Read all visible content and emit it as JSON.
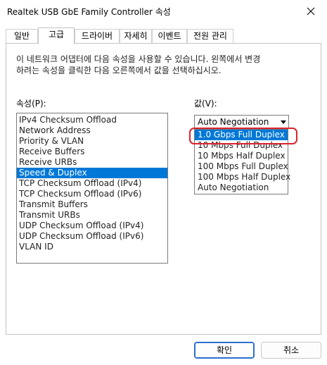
{
  "window": {
    "title": "Realtek USB GbE Family Controller 속성"
  },
  "tabs": [
    {
      "label": "일반",
      "active": false
    },
    {
      "label": "고급",
      "active": true
    },
    {
      "label": "드라이버",
      "active": false
    },
    {
      "label": "자세히",
      "active": false
    },
    {
      "label": "이벤트",
      "active": false
    },
    {
      "label": "전원 관리",
      "active": false
    }
  ],
  "advanced": {
    "description_line1": "이 네트워크 어댑터에 다음 속성을 사용할 수 있습니다. 왼쪽에서 변경",
    "description_line2": "하려는 속성을 클릭한 다음 오른쪽에서 값을 선택하십시오.",
    "property_label": "속성(P):",
    "value_label": "값(V):",
    "properties": [
      "IPv4 Checksum Offload",
      "Network Address",
      "Priority & VLAN",
      "Receive Buffers",
      "Receive URBs",
      "Speed & Duplex",
      "TCP Checksum Offload (IPv4)",
      "TCP Checksum Offload (IPv6)",
      "Transmit Buffers",
      "Transmit URBs",
      "UDP Checksum Offload (IPv4)",
      "UDP Checksum Offload (IPv6)",
      "VLAN ID"
    ],
    "selected_property": "Speed & Duplex",
    "value_selected": "Auto Negotiation",
    "value_options": [
      "1.0 Gbps Full Duplex",
      "10 Mbps Full Duplex",
      "10 Mbps Half Duplex",
      "100 Mbps Full Duplex",
      "100 Mbps Half Duplex",
      "Auto Negotiation"
    ],
    "highlighted_option": "1.0 Gbps Full Duplex"
  },
  "buttons": {
    "ok": "확인",
    "cancel": "취소"
  },
  "colors": {
    "selection": "#0078d7",
    "annotation": "#d9232d",
    "primary_border": "#2a6fcf"
  }
}
